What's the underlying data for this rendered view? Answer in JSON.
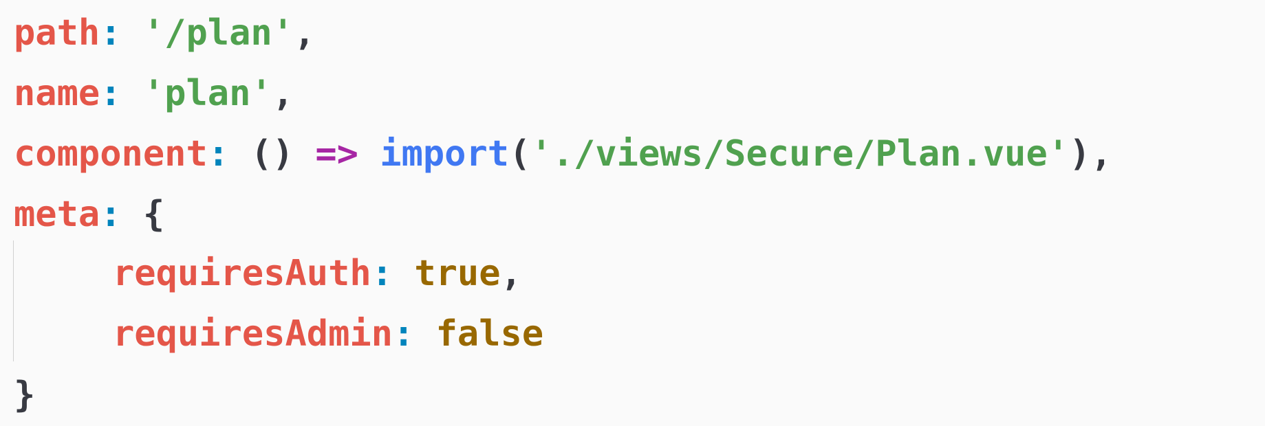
{
  "code": {
    "line1": {
      "key": "path",
      "colon": ":",
      "value": "'/plan'",
      "comma": ","
    },
    "line2": {
      "key": "name",
      "colon": ":",
      "value": "'plan'",
      "comma": ","
    },
    "line3": {
      "key": "component",
      "colon": ":",
      "parens": "()",
      "arrow": "=>",
      "fn": "import",
      "open_paren": "(",
      "value": "'./views/Secure/Plan.vue'",
      "close": "),"
    },
    "line4": {
      "key": "meta",
      "colon": ":",
      "brace": "{"
    },
    "line5": {
      "key": "requiresAuth",
      "colon": ":",
      "value": "true",
      "comma": ","
    },
    "line6": {
      "key": "requiresAdmin",
      "colon": ":",
      "value": "false"
    },
    "line7": {
      "brace": "}"
    }
  },
  "colors": {
    "background": "#fafafa",
    "property": "#e45649",
    "colon": "#0184bc",
    "string": "#50a14f",
    "arrow": "#a626a4",
    "function": "#4078f2",
    "boolean": "#986801",
    "punctuation": "#383a42"
  }
}
